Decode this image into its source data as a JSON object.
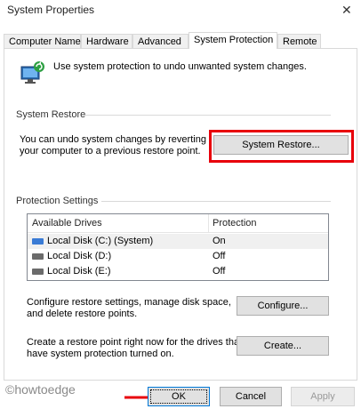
{
  "window": {
    "title": "System Properties",
    "close_glyph": "✕"
  },
  "tabs": [
    {
      "label": "Computer Name"
    },
    {
      "label": "Hardware"
    },
    {
      "label": "Advanced"
    },
    {
      "label": "System Protection"
    },
    {
      "label": "Remote"
    }
  ],
  "intro": {
    "text": "Use system protection to undo unwanted system changes.",
    "icon": "system-protection-shield-icon"
  },
  "system_restore": {
    "group_label": "System Restore",
    "description_line1": "You can undo system changes by reverting",
    "description_line2": "your computer to a previous restore point.",
    "button_label": "System Restore...",
    "highlight_color": "#e8000b"
  },
  "protection": {
    "group_label": "Protection Settings",
    "columns": [
      "Available Drives",
      "Protection"
    ],
    "drives": [
      {
        "name": "Local Disk (C:) (System)",
        "protection": "On",
        "icon": "system-drive-icon"
      },
      {
        "name": "Local Disk (D:)",
        "protection": "Off",
        "icon": "drive-icon"
      },
      {
        "name": "Local Disk (E:)",
        "protection": "Off",
        "icon": "drive-icon"
      }
    ]
  },
  "configure": {
    "line1": "Configure restore settings, manage disk space,",
    "line2": "and delete restore points.",
    "button_label": "Configure..."
  },
  "create": {
    "line1": "Create a restore point right now for the drives that",
    "line2": "have system protection turned on.",
    "button_label": "Create..."
  },
  "footer": {
    "ok_label": "OK",
    "cancel_label": "Cancel",
    "apply_label": "Apply",
    "watermark": "©howtoedge"
  }
}
